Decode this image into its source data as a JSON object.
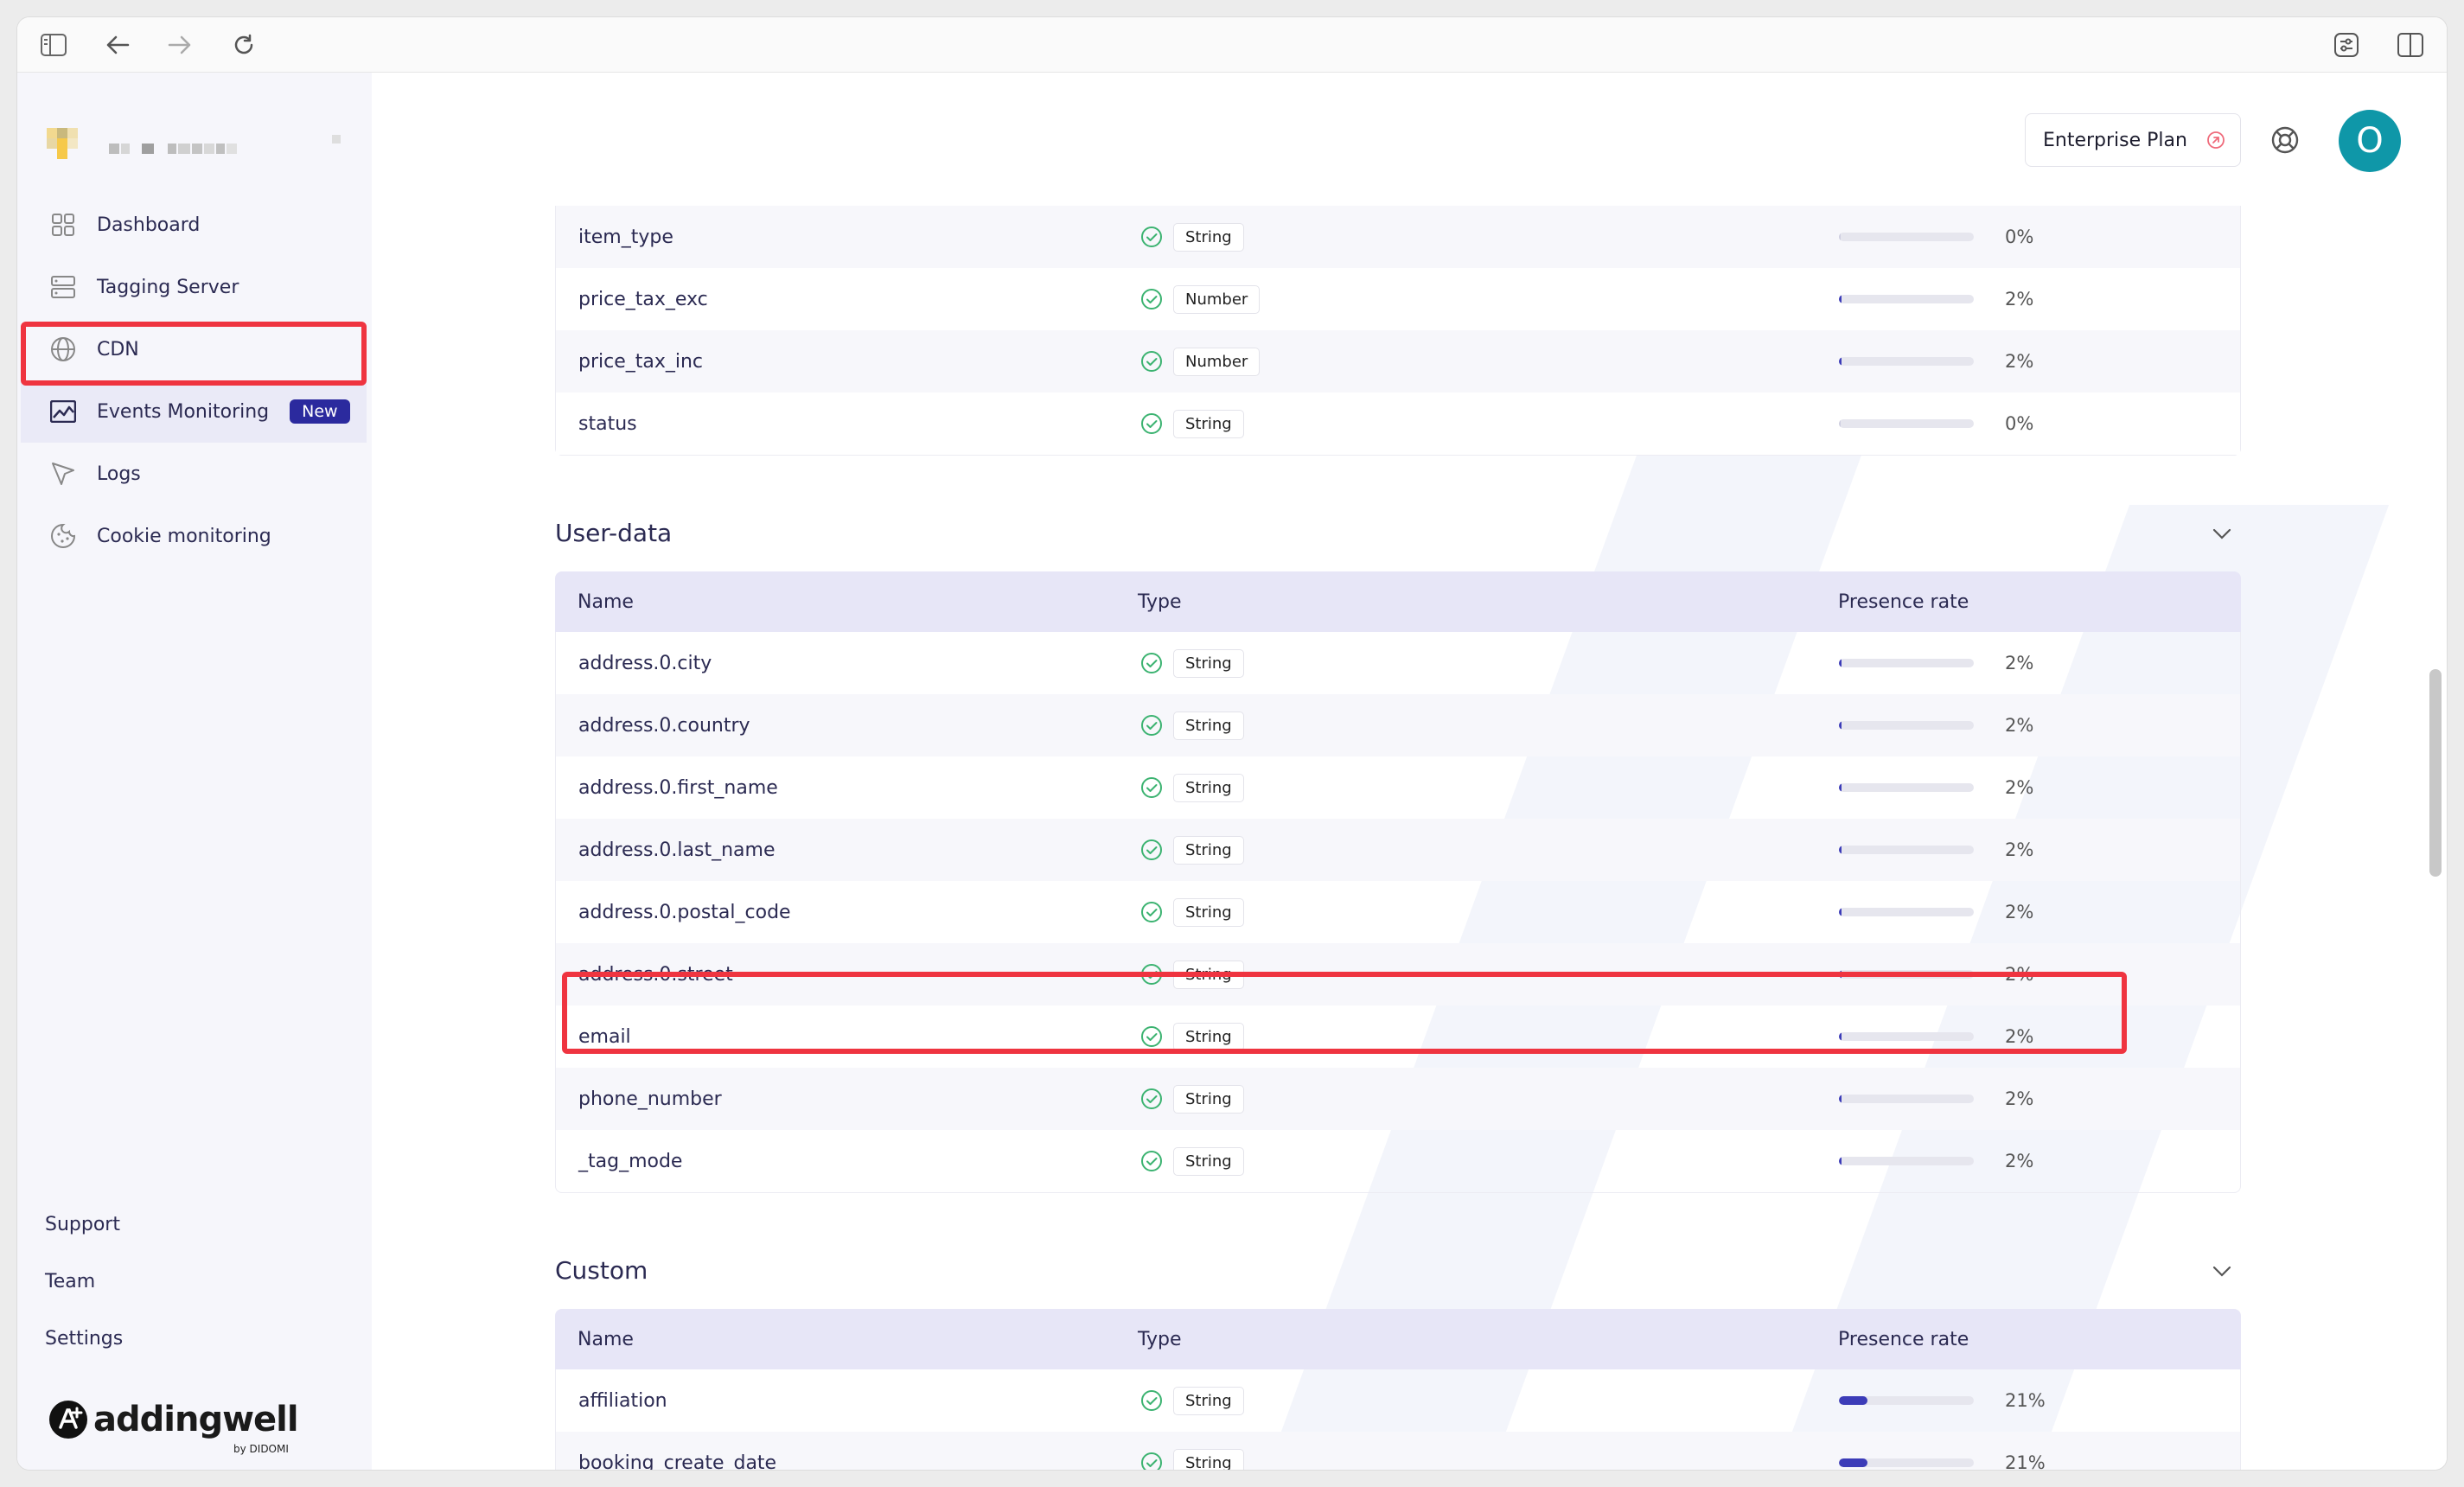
{
  "browser": {
    "sidebar_toggle_icon": "sidebar-icon",
    "back_icon": "arrow-left-icon",
    "forward_icon": "arrow-right-icon",
    "reload_icon": "reload-icon"
  },
  "sidebar": {
    "nav": [
      {
        "label": "Dashboard",
        "icon": "grid-icon"
      },
      {
        "label": "Tagging Server",
        "icon": "server-icon"
      },
      {
        "label": "CDN",
        "icon": "globe-icon"
      },
      {
        "label": "Events Monitoring",
        "icon": "chart-icon",
        "badge": "New",
        "active": true
      },
      {
        "label": "Logs",
        "icon": "cursor-icon"
      },
      {
        "label": "Cookie monitoring",
        "icon": "cookie-icon"
      }
    ],
    "bottom": {
      "support": "Support",
      "team": "Team",
      "settings": "Settings"
    },
    "brand": {
      "name": "addingwell",
      "sub": "by DIDOMI"
    }
  },
  "topbar": {
    "plan_label": "Enterprise Plan",
    "avatar_initial": "O"
  },
  "table_header": {
    "name": "Name",
    "type": "Type",
    "presence": "Presence rate"
  },
  "sections": {
    "previous_rows": [
      {
        "name": "item_type",
        "type": "String",
        "rate": 0,
        "pct": "0%"
      },
      {
        "name": "price_tax_exc",
        "type": "Number",
        "rate": 2,
        "pct": "2%"
      },
      {
        "name": "price_tax_inc",
        "type": "Number",
        "rate": 2,
        "pct": "2%"
      },
      {
        "name": "status",
        "type": "String",
        "rate": 0,
        "pct": "0%"
      }
    ],
    "user_data": {
      "title": "User-data",
      "rows": [
        {
          "name": "address.0.city",
          "type": "String",
          "rate": 2,
          "pct": "2%"
        },
        {
          "name": "address.0.country",
          "type": "String",
          "rate": 2,
          "pct": "2%"
        },
        {
          "name": "address.0.first_name",
          "type": "String",
          "rate": 2,
          "pct": "2%"
        },
        {
          "name": "address.0.last_name",
          "type": "String",
          "rate": 2,
          "pct": "2%"
        },
        {
          "name": "address.0.postal_code",
          "type": "String",
          "rate": 2,
          "pct": "2%"
        },
        {
          "name": "address.0.street",
          "type": "String",
          "rate": 2,
          "pct": "2%"
        },
        {
          "name": "email",
          "type": "String",
          "rate": 2,
          "pct": "2%",
          "highlight": true
        },
        {
          "name": "phone_number",
          "type": "String",
          "rate": 2,
          "pct": "2%"
        },
        {
          "name": "_tag_mode",
          "type": "String",
          "rate": 2,
          "pct": "2%"
        }
      ]
    },
    "custom": {
      "title": "Custom",
      "rows": [
        {
          "name": "affiliation",
          "type": "String",
          "rate": 21,
          "pct": "21%"
        },
        {
          "name": "booking_create_date",
          "type": "String",
          "rate": 21,
          "pct": "21%"
        }
      ]
    }
  },
  "colors": {
    "accent": "#2b2a9e",
    "highlight": "#ef3440",
    "avatar": "#0f97a8",
    "check": "#3cb371"
  }
}
